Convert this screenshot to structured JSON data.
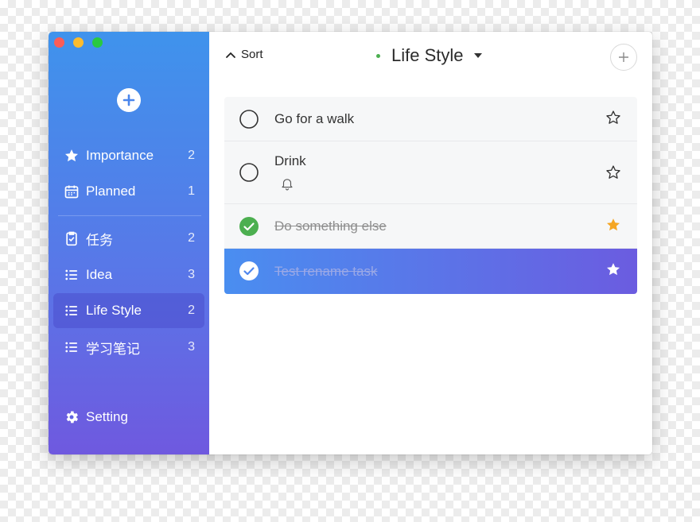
{
  "sidebar": {
    "nav": [
      {
        "label": "Importance",
        "count": "2",
        "icon": "star-icon"
      },
      {
        "label": "Planned",
        "count": "1",
        "icon": "calendar-icon"
      },
      {
        "label": "任务",
        "count": "2",
        "icon": "clipboard-check-icon"
      },
      {
        "label": "Idea",
        "count": "3",
        "icon": "list-icon"
      },
      {
        "label": "Life Style",
        "count": "2",
        "icon": "list-icon",
        "active": true
      },
      {
        "label": "学习笔记",
        "count": "3",
        "icon": "list-icon"
      }
    ],
    "setting_label": "Setting"
  },
  "header": {
    "sort_label": "Sort",
    "title": "Life Style"
  },
  "tasks": [
    {
      "text": "Go for a walk",
      "done": false,
      "starred": false
    },
    {
      "text": "Drink",
      "done": false,
      "starred": false,
      "reminder": true
    },
    {
      "text": "Do something else",
      "done": true,
      "starred": true
    },
    {
      "text": "Test rename task",
      "done": true,
      "starred": true,
      "selected": true
    }
  ],
  "colors": {
    "sidebar_top": "#3f93ec",
    "sidebar_bottom": "#6f59df",
    "done_green": "#4caf50",
    "star_gold": "#f5a623",
    "selected_start": "#4a8ef0",
    "selected_end": "#6b5ce0"
  }
}
